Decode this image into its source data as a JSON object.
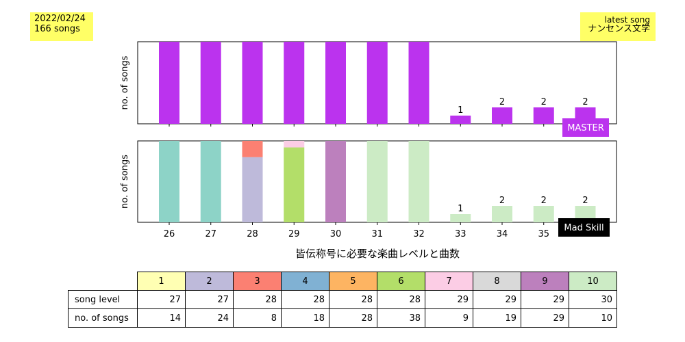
{
  "info": {
    "date": "2022/02/24",
    "count": "166 songs"
  },
  "latest": {
    "label": "latest song",
    "title": "ナンセンス文学"
  },
  "chart_data": [
    {
      "type": "bar",
      "categories": [
        26,
        27,
        28,
        29,
        30,
        31,
        32,
        33,
        34,
        35,
        36
      ],
      "ylabel": "no. of songs",
      "badge": "MASTER",
      "badge_color": "#bb33ee",
      "color": "#bb33ee",
      "values_note": "bars for 26–32 exceed the visible axis range",
      "values": [
        null,
        null,
        null,
        null,
        null,
        null,
        null,
        1,
        2,
        2,
        2
      ],
      "labels": [
        "",
        "",
        "",
        "",
        "",
        "",
        "",
        "1",
        "2",
        "2",
        "2"
      ]
    },
    {
      "type": "bar",
      "stacked": true,
      "categories": [
        26,
        27,
        28,
        29,
        30,
        31,
        32,
        33,
        34,
        35,
        36
      ],
      "ylabel": "no. of songs",
      "badge": "Mad Skill",
      "badge_color": "#000000",
      "values": [
        null,
        null,
        null,
        null,
        null,
        null,
        null,
        1,
        2,
        2,
        2
      ],
      "labels": [
        "",
        "",
        "",
        "",
        "",
        "",
        "",
        "1",
        "2",
        "2",
        "2"
      ],
      "segment_colors": [
        [
          "#8dd3c7"
        ],
        [
          "#8dd3c7"
        ],
        [
          "#bebada",
          "#fb8072"
        ],
        [
          "#b3de69",
          "#fccde5"
        ],
        [
          "#bc80bd"
        ],
        [
          "#ccebc5"
        ],
        [
          "#ccebc5"
        ],
        [
          "#ccebc5"
        ],
        [
          "#ccebc5"
        ],
        [
          "#ccebc5"
        ],
        [
          "#ccebc5"
        ]
      ],
      "xlabel": "皆伝称号に必要な楽曲レベルと曲数",
      "tick_labels": [
        "26",
        "27",
        "28",
        "29",
        "30",
        "31",
        "32",
        "33",
        "34",
        "35",
        "36"
      ]
    }
  ],
  "table": {
    "headers": [
      "1",
      "2",
      "3",
      "4",
      "5",
      "6",
      "7",
      "8",
      "9",
      "10"
    ],
    "header_colors": [
      "#ffffb3",
      "#bebada",
      "#fb8072",
      "#80b1d3",
      "#fdb462",
      "#b3de69",
      "#fccde5",
      "#d9d9d9",
      "#bc80bd",
      "#ccebc5"
    ],
    "row1_label": "song level",
    "row1": [
      "27",
      "27",
      "28",
      "28",
      "28",
      "28",
      "29",
      "29",
      "29",
      "30"
    ],
    "row2_label": "no. of songs",
    "row2": [
      "14",
      "24",
      "8",
      "18",
      "28",
      "38",
      "9",
      "19",
      "29",
      "10"
    ]
  }
}
